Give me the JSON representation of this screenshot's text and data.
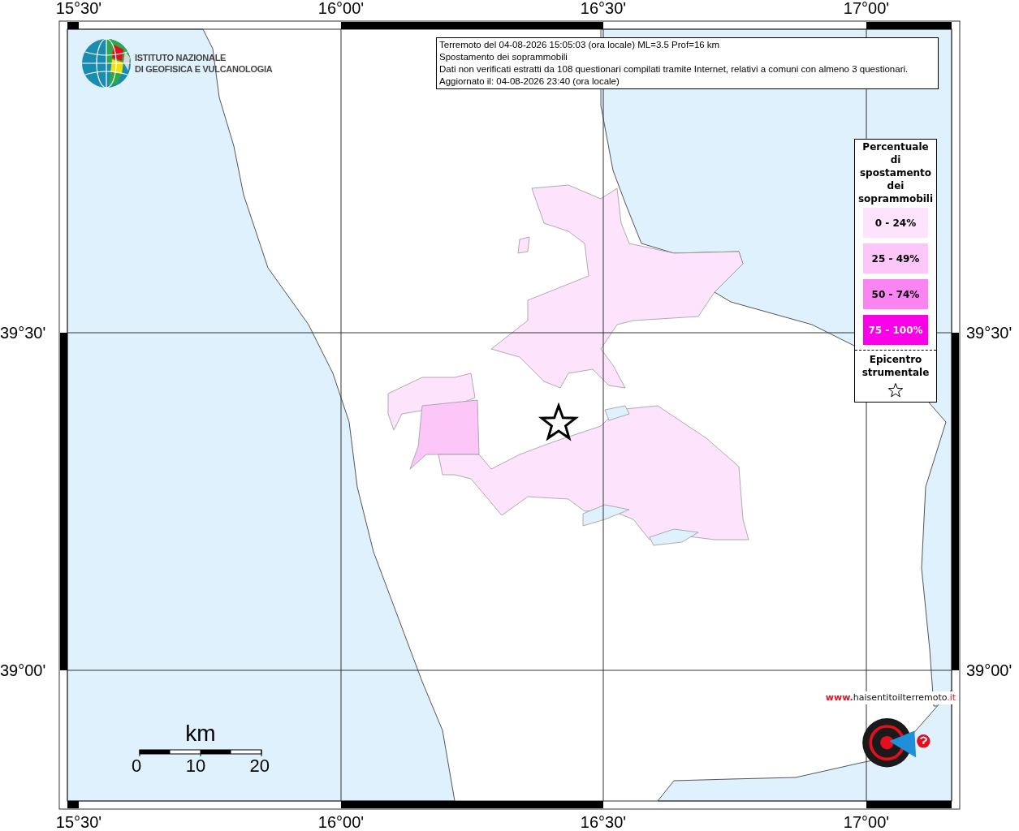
{
  "axis_labels": {
    "top": [
      "15°30'",
      "16°00'",
      "16°30'",
      "17°00'"
    ],
    "bottom": [
      "15°30'",
      "16°00'",
      "16°30'",
      "17°00'"
    ],
    "left": [
      "39°30'",
      "39°00'"
    ],
    "right": [
      "39°30'",
      "39°00'"
    ]
  },
  "logo": {
    "lines": [
      "ISTITUTO NAZIONALE",
      "DI GEOFISICA E VULCANOLOGIA"
    ]
  },
  "info_box": {
    "lines": [
      "Terremoto del 04-08-2026 15:05:03 (ora locale) ML=3.5 Prof=16 km",
      "Spostamento dei soprammobili",
      "Dati non verificati estratti da 108 questionari compilati tramite Internet, relativi a comuni con almeno 3 questionari.",
      "Aggiornato il: 04-08-2026 23:40 (ora locale)"
    ]
  },
  "legend": {
    "title": "Percentuale di spostamento dei soprammobili",
    "classes": [
      {
        "label": "0 - 24%",
        "color": "#fde3fb"
      },
      {
        "label": "25 - 49%",
        "color": "#fcc6f8"
      },
      {
        "label": "50 - 74%",
        "color": "#fb84f3"
      },
      {
        "label": "75 - 100%",
        "color": "#f900e8"
      }
    ],
    "epicenter_label": "Epicentro strumentale"
  },
  "scale": {
    "unit": "km",
    "ticks": [
      "0",
      "10",
      "20"
    ]
  },
  "site_logo": {
    "name": "haisentitoilterremoto",
    "domain": ".it",
    "prefix": "www."
  }
}
